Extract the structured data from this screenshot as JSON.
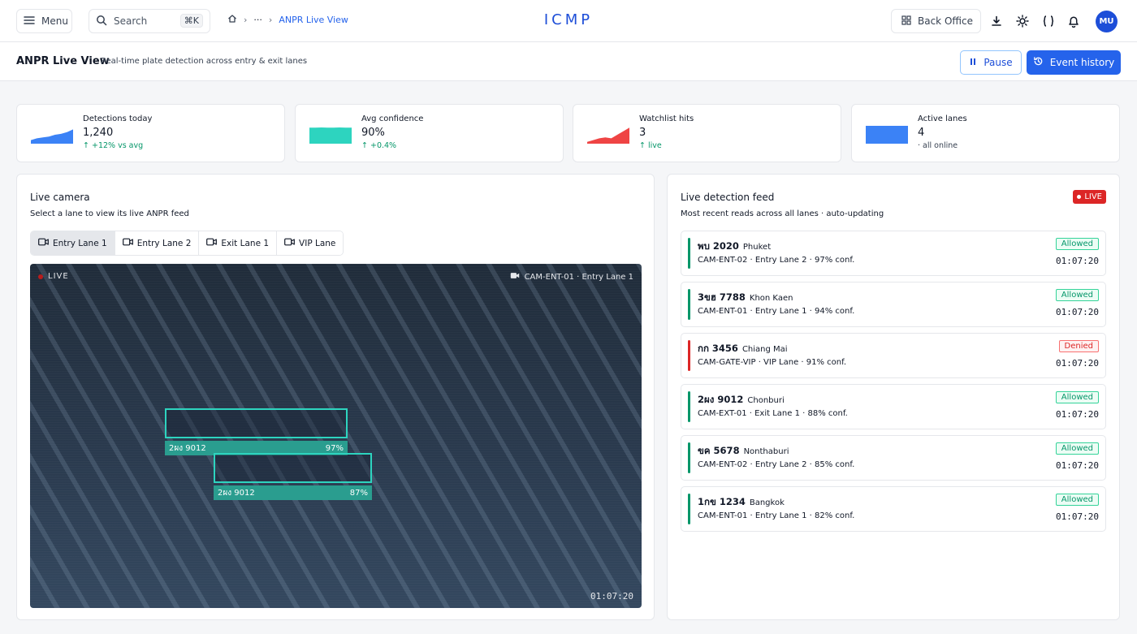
{
  "topbar": {
    "menu_label": "Menu",
    "search_label": "Search",
    "search_shortcut": "⌘K",
    "breadcrumb_ellipsis": "···",
    "breadcrumb_current": "ANPR Live View",
    "brand": "ICMP",
    "back_office_label": "Back Office",
    "avatar_initials": "MU"
  },
  "page": {
    "title": "ANPR Live View",
    "subtitle": "Real-time plate detection across entry & exit lanes",
    "pause_label": "Pause",
    "history_label": "Event history"
  },
  "kpis": [
    {
      "label": "Detections today",
      "value": "1,240",
      "delta": "↑ +12% vs avg",
      "color": "#3b82f6",
      "sparkline": [
        0.2,
        0.3,
        0.35,
        0.4,
        0.5,
        0.55,
        0.65,
        0.8
      ]
    },
    {
      "label": "Avg confidence",
      "value": "90%",
      "delta": "↑ +0.4%",
      "color": "#2dd4bf",
      "sparkline": [
        0.9,
        0.9,
        0.91,
        0.9,
        0.9,
        0.91,
        0.9,
        0.9
      ]
    },
    {
      "label": "Watchlist hits",
      "value": "3",
      "delta": "↑ live",
      "color": "#ef4444",
      "sparkline": [
        0.1,
        0.2,
        0.3,
        0.35,
        0.3,
        0.5,
        0.7,
        0.9
      ]
    },
    {
      "label": "Active lanes",
      "value": "4",
      "delta": "· all online",
      "color": "#3b82f6",
      "sparkline": [
        1,
        1,
        1,
        1,
        1,
        1,
        1,
        1
      ]
    }
  ],
  "camera_panel": {
    "title": "Live camera",
    "subtitle": "Select a lane to view its live ANPR feed",
    "tabs": [
      {
        "label": "Entry Lane 1",
        "active": true
      },
      {
        "label": "Entry Lane 2",
        "active": false
      },
      {
        "label": "Exit Lane 1",
        "active": false
      },
      {
        "label": "VIP Lane",
        "active": false
      }
    ],
    "live_label": "LIVE",
    "camera_label": "CAM-ENT-01 · Entry Lane 1",
    "timestamp": "01:07:20",
    "detections": [
      {
        "plate": "2ผง 9012",
        "confidence": "97%"
      },
      {
        "plate": "2ผง 9012",
        "confidence": "87%"
      }
    ]
  },
  "feed_panel": {
    "title": "Live detection feed",
    "subtitle": "Most recent reads across all lanes · auto-updating",
    "live_badge": "LIVE",
    "items": [
      {
        "plate": "พบ 2020",
        "city": "Phuket",
        "meta": "CAM-ENT-02 · Entry Lane 2 · 97% conf.",
        "status": "Allowed",
        "time": "01:07:20"
      },
      {
        "plate": "3ขฮ 7788",
        "city": "Khon Kaen",
        "meta": "CAM-ENT-01 · Entry Lane 1 · 94% conf.",
        "status": "Allowed",
        "time": "01:07:20"
      },
      {
        "plate": "กก 3456",
        "city": "Chiang Mai",
        "meta": "CAM-GATE-VIP · VIP Lane · 91% conf.",
        "status": "Denied",
        "time": "01:07:20"
      },
      {
        "plate": "2ผง 9012",
        "city": "Chonburi",
        "meta": "CAM-EXT-01 · Exit Lane 1 · 88% conf.",
        "status": "Allowed",
        "time": "01:07:20"
      },
      {
        "plate": "ขค 5678",
        "city": "Nonthaburi",
        "meta": "CAM-ENT-02 · Entry Lane 2 · 85% conf.",
        "status": "Allowed",
        "time": "01:07:20"
      },
      {
        "plate": "1กข 1234",
        "city": "Bangkok",
        "meta": "CAM-ENT-01 · Entry Lane 1 · 82% conf.",
        "status": "Allowed",
        "time": "01:07:20"
      }
    ]
  },
  "colors": {
    "accent": "#2563eb",
    "allowed": "#059669",
    "denied": "#dc2626",
    "detection": "#2dd4bf"
  }
}
